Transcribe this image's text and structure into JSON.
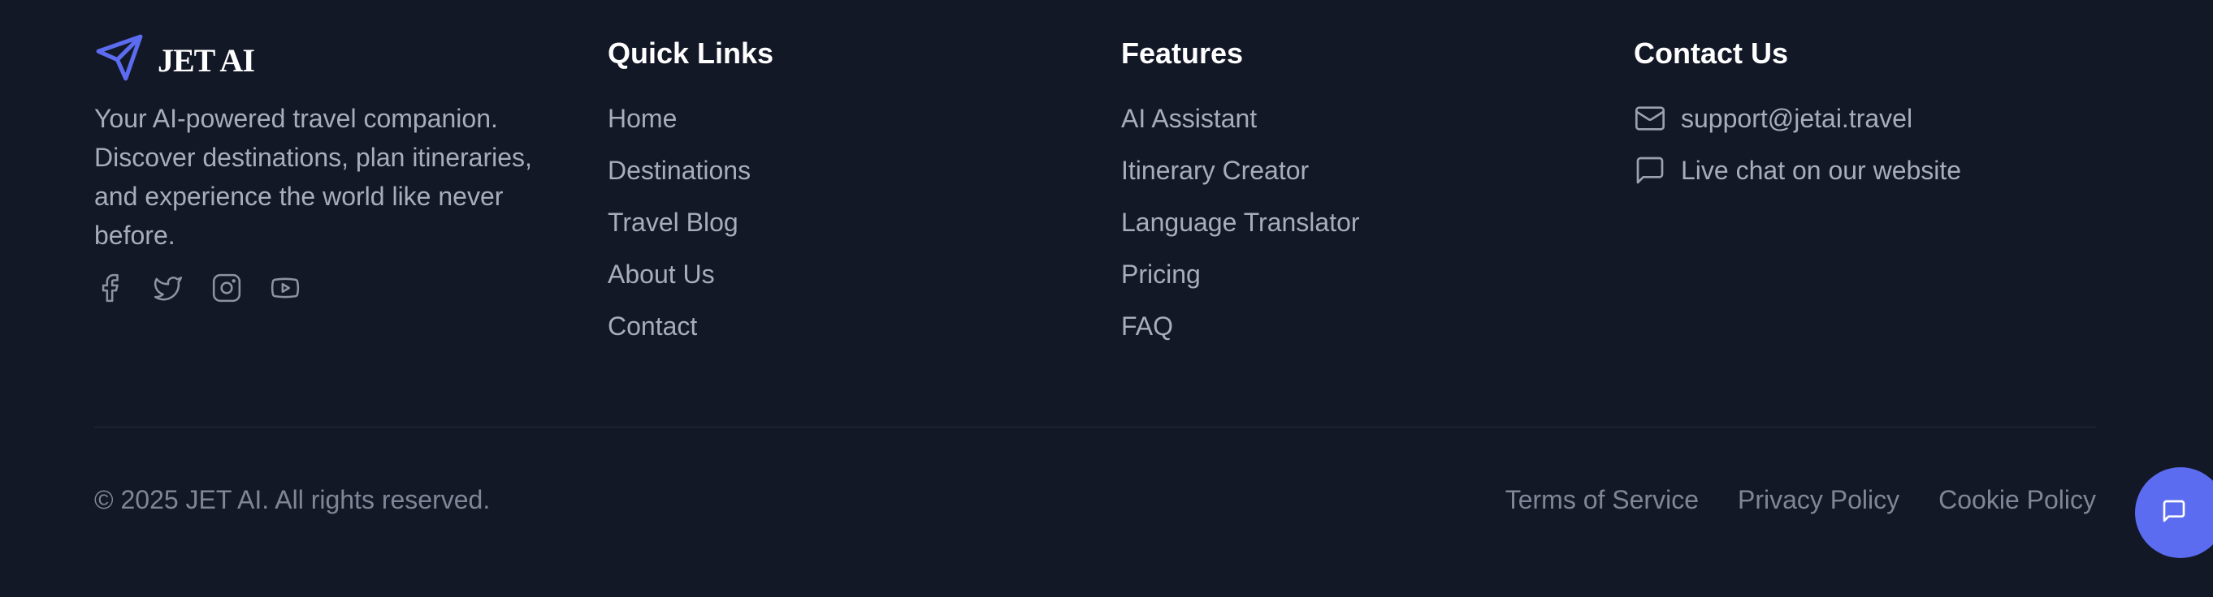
{
  "brand": {
    "name": "JET AI",
    "tagline": "Your AI-powered travel companion. Discover destinations, plan itineraries, and experience the world like never before.",
    "logo_icon": "paper-plane-icon",
    "accent_color": "#5b6cf0",
    "socials": [
      "facebook-icon",
      "twitter-icon",
      "instagram-icon",
      "youtube-icon"
    ]
  },
  "quick_links": {
    "heading": "Quick Links",
    "items": [
      "Home",
      "Destinations",
      "Travel Blog",
      "About Us",
      "Contact"
    ]
  },
  "features": {
    "heading": "Features",
    "items": [
      "AI Assistant",
      "Itinerary Creator",
      "Language Translator",
      "Pricing",
      "FAQ"
    ]
  },
  "contact": {
    "heading": "Contact Us",
    "email": "support@jetai.travel",
    "chat": "Live chat on our website"
  },
  "bottom": {
    "copyright": "© 2025 JET AI. All rights reserved.",
    "legal": [
      "Terms of Service",
      "Privacy Policy",
      "Cookie Policy"
    ]
  },
  "chat_button": {
    "icon": "chat-bubble-icon",
    "color": "#5b6cf0"
  },
  "colors": {
    "background": "#131827",
    "heading": "#ffffff",
    "text": "#a6adbb"
  }
}
